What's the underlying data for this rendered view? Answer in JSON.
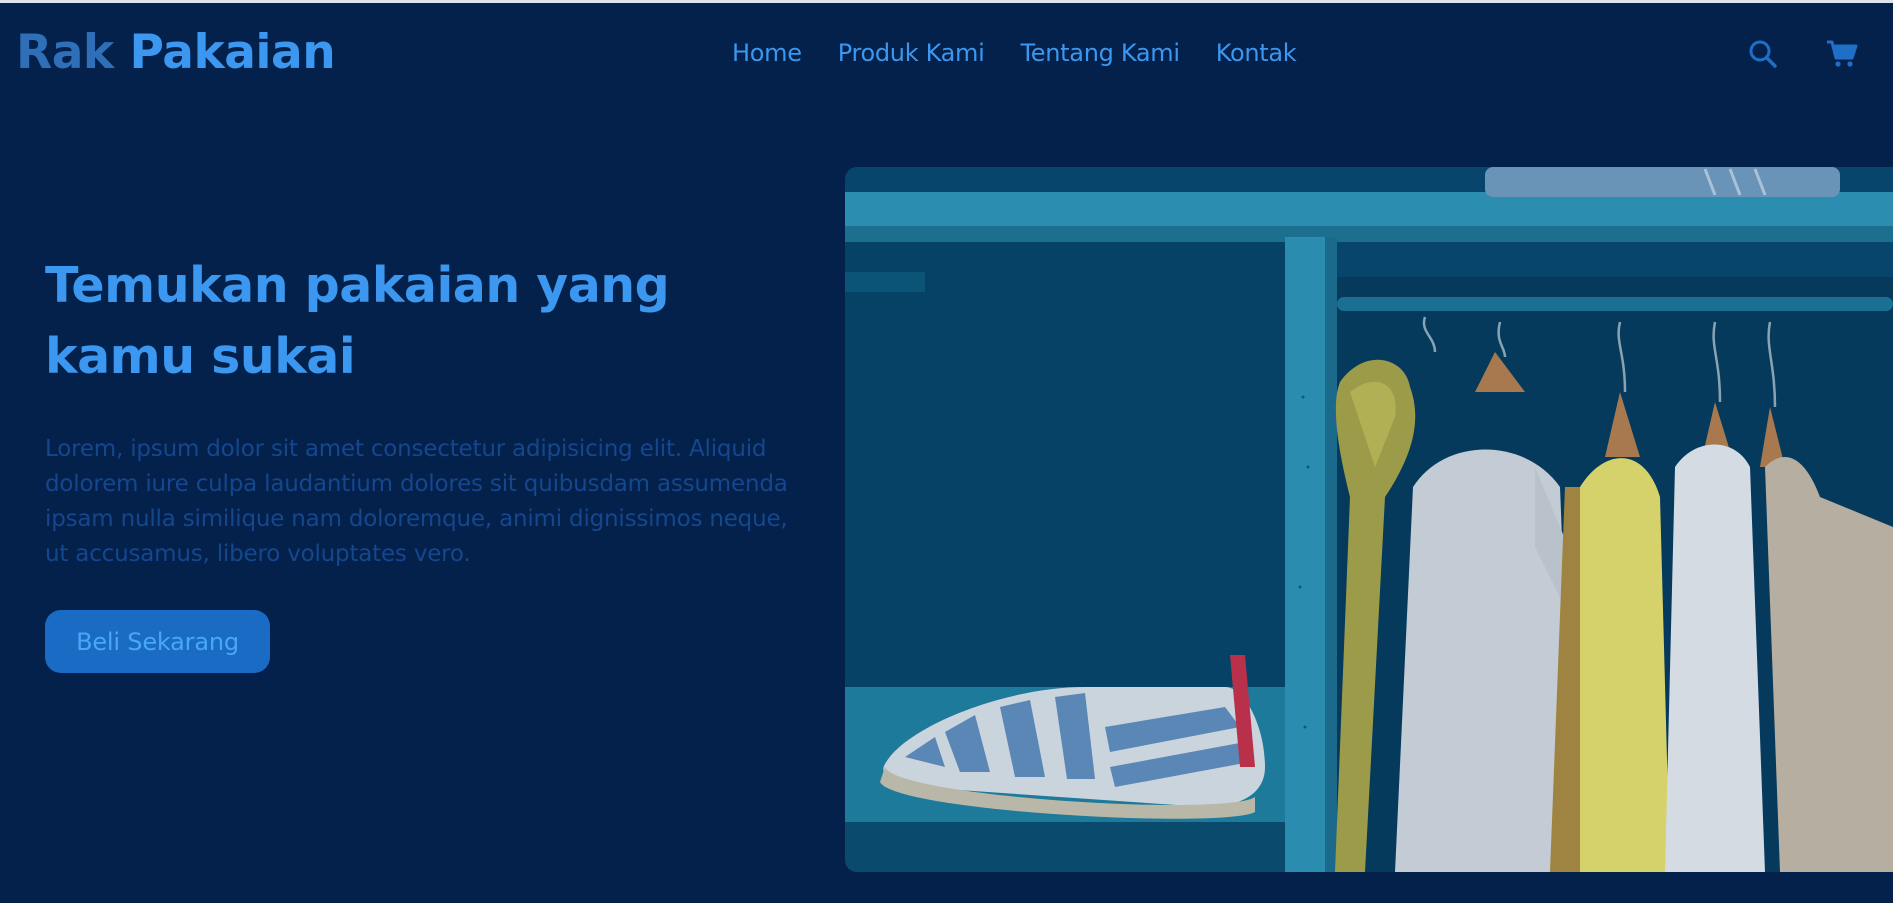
{
  "brand": {
    "part1": "Rak",
    "part2": "Pakaian"
  },
  "nav": {
    "links": [
      {
        "label": "Home"
      },
      {
        "label": "Produk Kami"
      },
      {
        "label": "Tentang Kami"
      },
      {
        "label": "Kontak"
      }
    ],
    "icons": [
      "search-icon",
      "cart-icon"
    ]
  },
  "hero": {
    "title": "Temukan pakaian yang kamu sukai",
    "text": "Lorem, ipsum dolor sit amet consectetur adipisicing elit. Aliquid dolorem iure culpa laudantium dolores sit quibusdam assumenda ipsam nulla similique nam doloremque, animi dignissimos neque, ut accusamus, libero voluptates vero.",
    "cta_label": "Beli Sekarang"
  },
  "colors": {
    "background": "#03214a",
    "accent": "#3b97ef",
    "button": "#1a6bc3"
  }
}
